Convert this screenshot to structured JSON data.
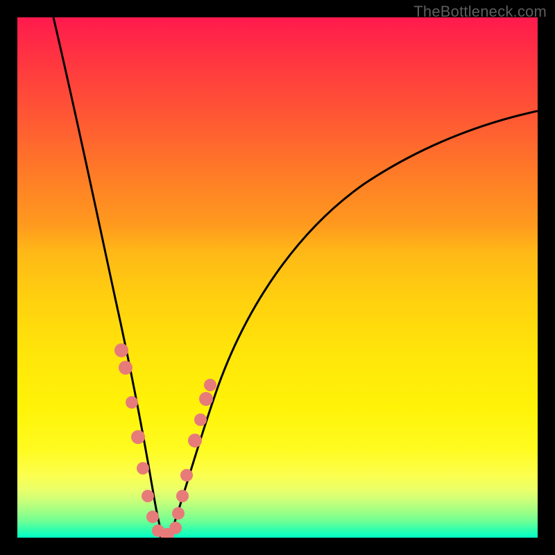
{
  "watermark": "TheBottleneck.com",
  "domain": "Chart",
  "chart_data": {
    "type": "line",
    "title": "",
    "xlabel": "",
    "ylabel": "",
    "xlim": [
      0,
      100
    ],
    "ylim": [
      0,
      100
    ],
    "background_gradient": {
      "top_color": "#ff1a4d",
      "mid_colors": [
        "#ff9a1e",
        "#ffe60a"
      ],
      "bottom_color": "#00ffc7"
    },
    "series": [
      {
        "name": "left-curve",
        "stroke": "#000000",
        "x": [
          7,
          10,
          13,
          16,
          18,
          20,
          22,
          23.5,
          25,
          26,
          27
        ],
        "y": [
          100,
          82,
          66,
          51,
          40,
          30,
          20,
          12,
          6,
          2,
          0
        ]
      },
      {
        "name": "right-curve",
        "stroke": "#000000",
        "x": [
          27,
          29,
          31,
          33,
          36,
          40,
          46,
          55,
          65,
          78,
          92,
          100
        ],
        "y": [
          0,
          5,
          12,
          19,
          28,
          38,
          49,
          60,
          68,
          75,
          80,
          82
        ]
      }
    ],
    "markers": [
      {
        "name": "curve-markers",
        "color": "#e77b79",
        "radius_px": 9,
        "points_xy": [
          [
            19,
            35
          ],
          [
            19.8,
            31
          ],
          [
            21,
            26
          ],
          [
            22.5,
            18
          ],
          [
            23.5,
            12
          ],
          [
            24.4,
            8
          ],
          [
            25.2,
            4
          ],
          [
            26.2,
            1.5
          ],
          [
            28,
            0.5
          ],
          [
            29.5,
            2
          ],
          [
            30,
            5
          ],
          [
            30.5,
            8
          ],
          [
            31,
            12
          ],
          [
            33,
            19
          ],
          [
            34.2,
            23
          ],
          [
            35.4,
            27
          ],
          [
            36,
            29
          ]
        ]
      }
    ]
  }
}
